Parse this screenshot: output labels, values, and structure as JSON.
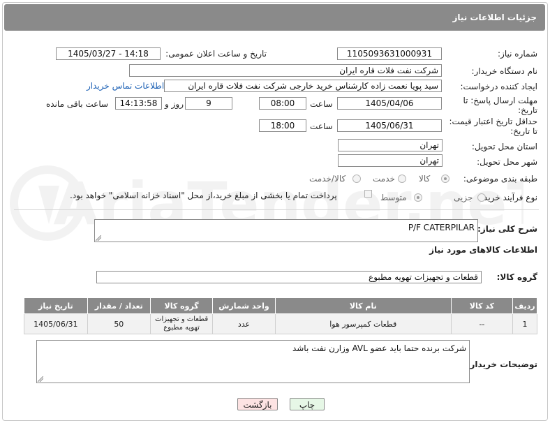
{
  "header": {
    "title": "جزئیات اطلاعات نیاز"
  },
  "form": {
    "need_number_label": "شماره نیاز:",
    "need_number": "1105093631000931",
    "announce_datetime_label": "تاریخ و ساعت اعلان عمومی:",
    "announce_datetime": "1405/03/27 - 14:18",
    "buyer_org_label": "نام دستگاه خریدار:",
    "buyer_org": "شرکت نفت فلات قاره ایران",
    "requester_label": "ایجاد کننده درخواست:",
    "requester": "سید پویا نعمت زاده کارشناس خرید خارجی شرکت نفت فلات قاره ایران",
    "buyer_contact_link": "اطلاعات تماس خریدار",
    "reply_deadline_label_1": "مهلت ارسال پاسخ: تا",
    "reply_deadline_label_2": "تاریخ:",
    "reply_date": "1405/04/06",
    "time_label": "ساعت",
    "reply_time": "08:00",
    "days_value": "9",
    "days_label": "روز و",
    "remaining_time": "14:13:58",
    "remaining_label": "ساعت باقی مانده",
    "price_validity_label_1": "حداقل تاریخ اعتبار قیمت:",
    "price_validity_label_2": "تا تاریخ:",
    "price_date": "1405/06/31",
    "price_time": "18:00",
    "province_label": "استان محل تحویل:",
    "province": "تهران",
    "city_label": "شهر محل تحویل:",
    "city": "تهران",
    "category_label": "طبقه بندی موضوعی:",
    "category_options": [
      "کالا",
      "خدمت",
      "کالا/خدمت"
    ],
    "category_selected": "کالا",
    "process_label": "نوع فرآیند خرید :",
    "process_options": [
      "جزیی",
      "متوسط"
    ],
    "process_selected": "متوسط",
    "payment_note": "پرداخت تمام یا بخشی از مبلغ خرید،از محل \"اسناد خزانه اسلامی\" خواهد بود.",
    "general_desc_label": "شرح کلی نیاز:",
    "general_desc": "P/F CATERPILAR",
    "goods_info_title": "اطلاعات کالاهای مورد نیاز",
    "goods_group_label": "گروه کالا:",
    "goods_group": "قطعات و تجهیزات تهویه مطبوع"
  },
  "table": {
    "headers": [
      "ردیف",
      "کد کالا",
      "نام کالا",
      "واحد شمارش",
      "گروه کالا",
      "تعداد / مقدار",
      "تاریخ نیاز"
    ],
    "rows": [
      [
        "1",
        "--",
        "قطعات کمپرسور هوا",
        "عدد",
        "قطعات و تجهیزات تهویه مطبوع",
        "50",
        "1405/06/31"
      ]
    ]
  },
  "buyer_notes_label": "توضیحات خریدار:",
  "buyer_notes": "شرکت برنده حتما باید عضو AVL وزارن نفت باشد",
  "buttons": {
    "print": "چاپ",
    "back": "بازگشت"
  },
  "watermark": {
    "text": "AriaTender.neT"
  },
  "colors": {
    "header_bg": "#8a8a8a",
    "link": "#1a5fb4",
    "print_btn": "#e6f7e6",
    "back_btn": "#fde3e3"
  }
}
